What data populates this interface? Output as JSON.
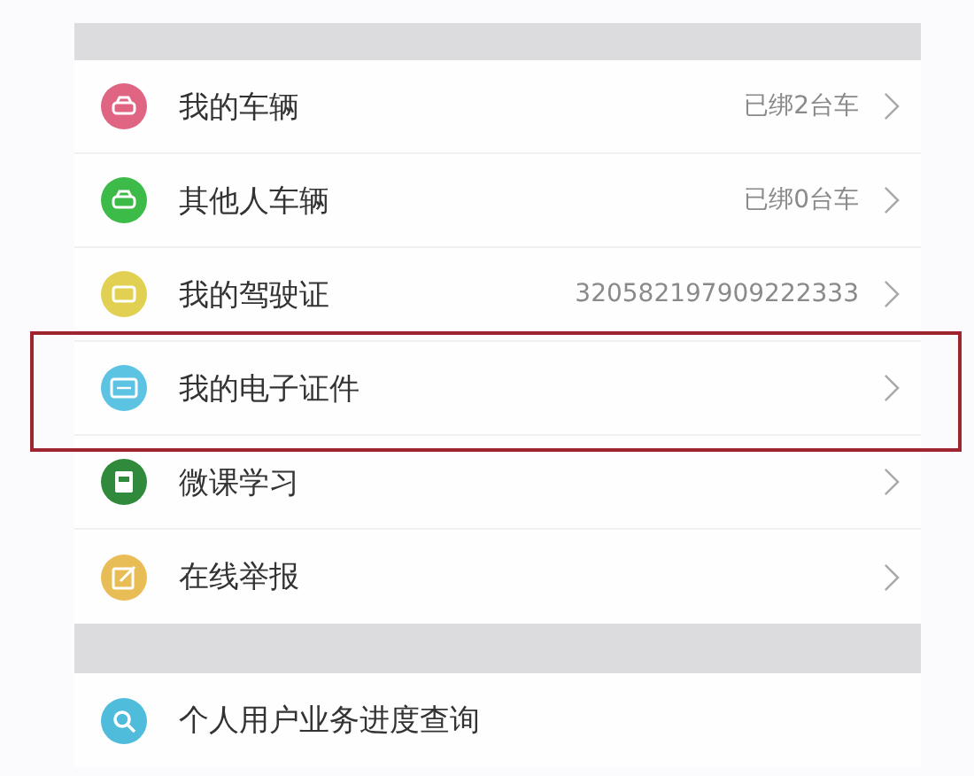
{
  "sections": [
    {
      "items": [
        {
          "kind": "car",
          "color": "#e06583",
          "label": "我的车辆",
          "value": "已绑2台车",
          "chevron": true,
          "highlighted": false
        },
        {
          "kind": "car",
          "color": "#3dbb48",
          "label": "其他人车辆",
          "value": "已绑0台车",
          "chevron": true,
          "highlighted": false
        },
        {
          "kind": "license",
          "color": "#e2d052",
          "label": "我的驾驶证",
          "value": "320582197909222333",
          "chevron": true,
          "highlighted": false
        },
        {
          "kind": "card",
          "color": "#5cc3e3",
          "label": "我的电子证件",
          "chevron": true,
          "highlighted": true
        },
        {
          "kind": "book",
          "color": "#2f8a3c",
          "label": "微课学习",
          "chevron": true,
          "highlighted": false
        },
        {
          "kind": "edit",
          "color": "#e9bd55",
          "label": "在线举报",
          "chevron": true,
          "highlighted": false
        }
      ]
    },
    {
      "items": [
        {
          "kind": "search",
          "color": "#4fbcdc",
          "label": "个人用户业务进度查询",
          "chevron": false,
          "highlighted": false
        }
      ]
    }
  ]
}
